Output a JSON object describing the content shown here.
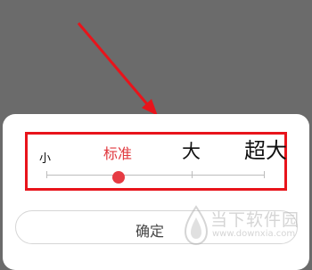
{
  "dialog": {
    "size_options": [
      "小",
      "标准",
      "大",
      "超大"
    ],
    "selected_index": 1,
    "confirm_label": "确定"
  },
  "watermark": {
    "brand_cn": "当下软件园",
    "brand_url": "www.downxia.com"
  },
  "colors": {
    "overlay": "#6b6b6b",
    "highlight": "#e8141b",
    "selected": "#e63b43"
  }
}
